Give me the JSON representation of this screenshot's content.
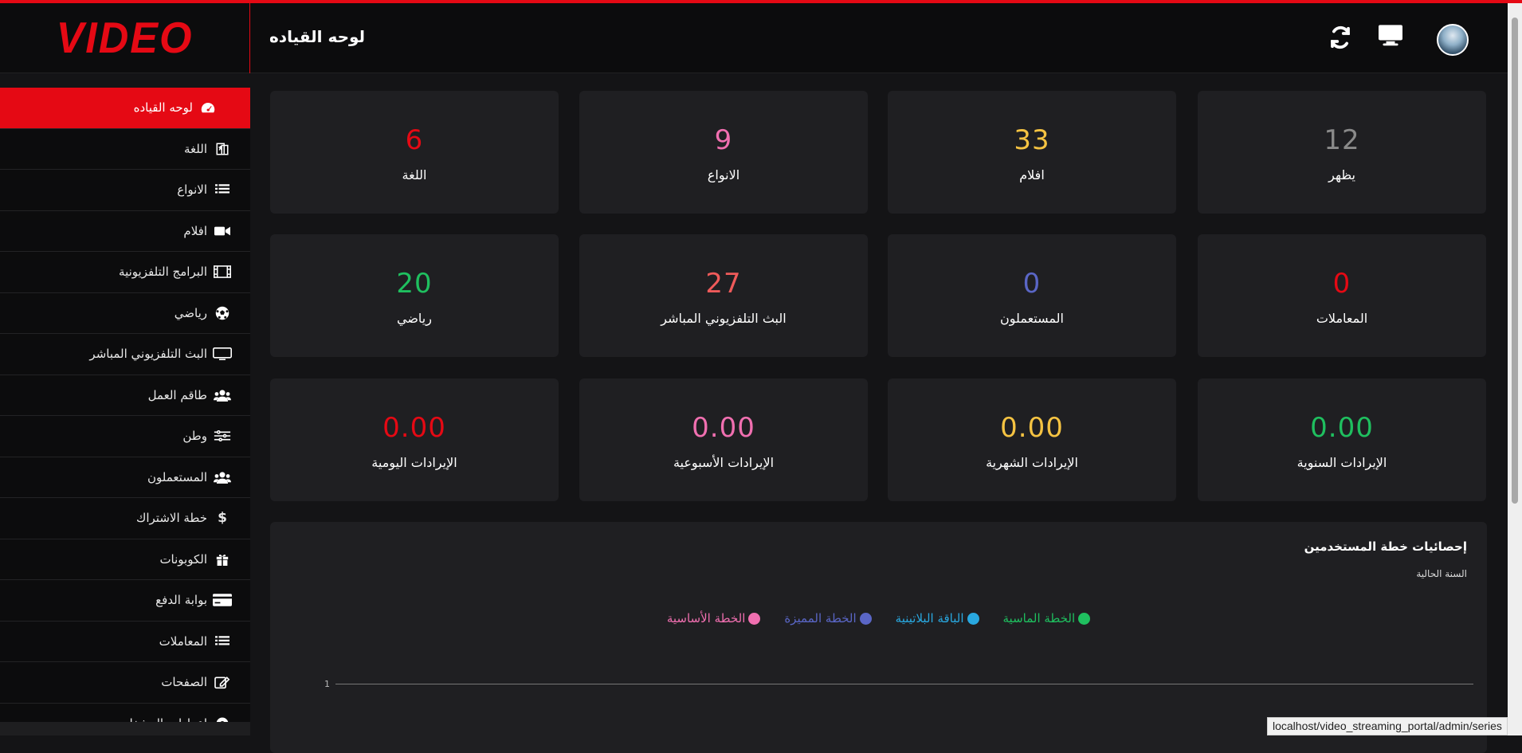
{
  "brand": {
    "logo_text": "VIDEO",
    "accent": "#e50914"
  },
  "header": {
    "title": "لوحه القياده",
    "icons": [
      "refresh-icon",
      "monitor-icon",
      "avatar"
    ]
  },
  "sidebar": {
    "items": [
      {
        "label": "لوحه القياده",
        "icon": "dashboard-icon",
        "active": true
      },
      {
        "label": "اللغة",
        "icon": "language-icon"
      },
      {
        "label": "الانواع",
        "icon": "list-icon"
      },
      {
        "label": "افلام",
        "icon": "video-camera-icon"
      },
      {
        "label": "البرامج التلفزيونية",
        "icon": "film-icon"
      },
      {
        "label": "رياضي",
        "icon": "soccer-ball-icon"
      },
      {
        "label": "البث التلفزيوني المباشر",
        "icon": "tv-icon"
      },
      {
        "label": "طاقم العمل",
        "icon": "users-icon"
      },
      {
        "label": "وطن",
        "icon": "sliders-icon"
      },
      {
        "label": "المستعملون",
        "icon": "users-icon"
      },
      {
        "label": "خطة الاشتراك",
        "icon": "dollar-icon"
      },
      {
        "label": "الكوبونات",
        "icon": "gift-icon"
      },
      {
        "label": "بوابة الدفع",
        "icon": "credit-card-icon"
      },
      {
        "label": "المعاملات",
        "icon": "list-icon"
      },
      {
        "label": "الصفحات",
        "icon": "edit-icon"
      },
      {
        "label": "إعدادات المشغل",
        "icon": "settings-icon"
      }
    ]
  },
  "stats": [
    {
      "value": "6",
      "label": "اللغة",
      "color": "#e50914"
    },
    {
      "value": "9",
      "label": "الانواع",
      "color": "#f06fb0"
    },
    {
      "value": "33",
      "label": "افلام",
      "color": "#f5c342"
    },
    {
      "value": "12",
      "label": "يظهر",
      "color": "#8a8a8a"
    },
    {
      "value": "20",
      "label": "رياضي",
      "color": "#1fbf5f"
    },
    {
      "value": "27",
      "label": "البث التلفزيوني المباشر",
      "color": "#ef5a5a"
    },
    {
      "value": "0",
      "label": "المستعملون",
      "color": "#5a66c6"
    },
    {
      "value": "0",
      "label": "المعاملات",
      "color": "#e50914"
    },
    {
      "value": "0.00",
      "label": "الإيرادات اليومية",
      "color": "#e50914"
    },
    {
      "value": "0.00",
      "label": "الإيرادات الأسبوعية",
      "color": "#f06fb0"
    },
    {
      "value": "0.00",
      "label": "الإيرادات الشهرية",
      "color": "#f5c342"
    },
    {
      "value": "0.00",
      "label": "الإيرادات السنوية",
      "color": "#1fbf5f"
    }
  ],
  "chart": {
    "title": "إحصائيات خطة المستخدمين",
    "subtitle": "السنة الحالية",
    "legend": [
      {
        "label": "الخطة الماسية",
        "color": "#1fbf5f"
      },
      {
        "label": "الباقة البلاتينية",
        "color": "#29a8e0"
      },
      {
        "label": "الخطة المميزة",
        "color": "#5a66c6"
      },
      {
        "label": "الخطة الأساسية",
        "color": "#f06fb0"
      }
    ],
    "y_tick": "1"
  },
  "status_bar": {
    "url": "localhost/video_streaming_portal/admin/series"
  }
}
